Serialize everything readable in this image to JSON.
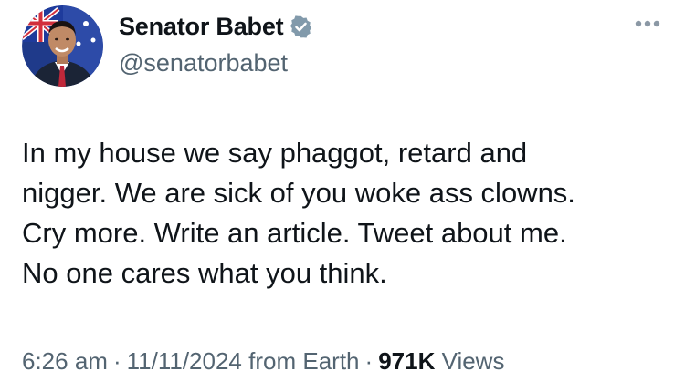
{
  "tweet": {
    "author": {
      "display_name": "Senator Babet",
      "handle": "@senatorbabet",
      "verified": true
    },
    "icons": {
      "verified": "verified-badge-icon",
      "more": "more-options-icon",
      "avatar": "profile-photo"
    },
    "body": "In my house we say phaggot, retard and\nnigger. We are sick of you woke ass clowns.\nCry more. Write an article. Tweet about me.\nNo one cares what you think.",
    "meta": {
      "time": "6:26 am",
      "date": "11/11/2024",
      "source": "from Earth",
      "separator": "·",
      "views_count": "971K",
      "views_label": "Views"
    },
    "colors": {
      "text_primary": "#0f1419",
      "text_secondary": "#536471",
      "verified_badge": "#829aab"
    }
  }
}
